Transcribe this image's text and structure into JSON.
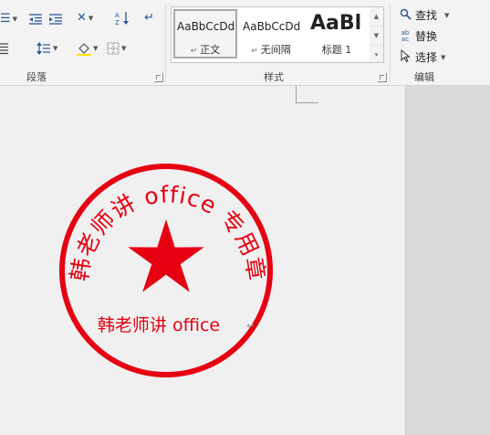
{
  "ribbon": {
    "paragraph": {
      "group_label": "段落"
    },
    "styles": {
      "group_label": "样式",
      "tiles": [
        {
          "sample": "AaBbCcDd",
          "name": "正文"
        },
        {
          "sample": "AaBbCcDd",
          "name": "无间隔"
        },
        {
          "sample": "AaBl",
          "name": "标题 1"
        }
      ]
    },
    "editing": {
      "group_label": "编辑",
      "find_label": "查找",
      "replace_label": "替换",
      "select_label": "选择",
      "replace_icon_text": "ab ac"
    }
  },
  "seal": {
    "arc_text": "韩老师讲 office 专用章",
    "inner_text": "韩老师讲 office",
    "color": "#e60012"
  },
  "colors": {
    "ribbon_bg": "#f3f3f3",
    "page_bg": "#f0f0f0",
    "seal_red": "#e60012",
    "accent_blue": "#2b579a"
  }
}
